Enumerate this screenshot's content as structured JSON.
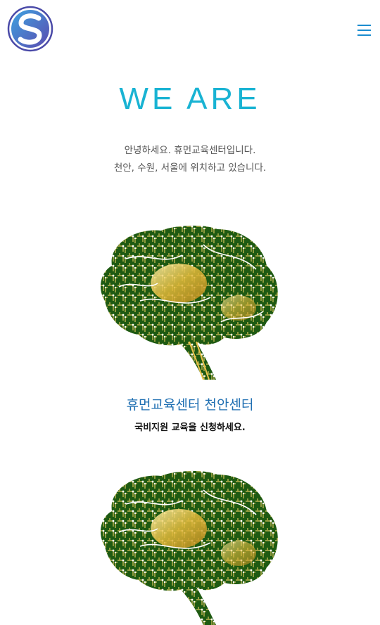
{
  "header": {
    "logo_icon": "s-circle-logo-icon",
    "menu_icon": "hamburger-menu-icon",
    "accent_color": "#1b8ccf"
  },
  "hero": {
    "title": "WE ARE",
    "title_color": "#19b3d3",
    "intro_line1": "안녕하세요. 휴먼교육센터입니다.",
    "intro_line2": "천안, 수원, 서울에 위치하고 있습니다."
  },
  "centers": [
    {
      "image_icon": "circuit-brain-icon",
      "title": "휴먼교육센터 천안센터",
      "description": "국비지원 교육을 신청하세요."
    },
    {
      "image_icon": "circuit-brain-icon"
    }
  ]
}
